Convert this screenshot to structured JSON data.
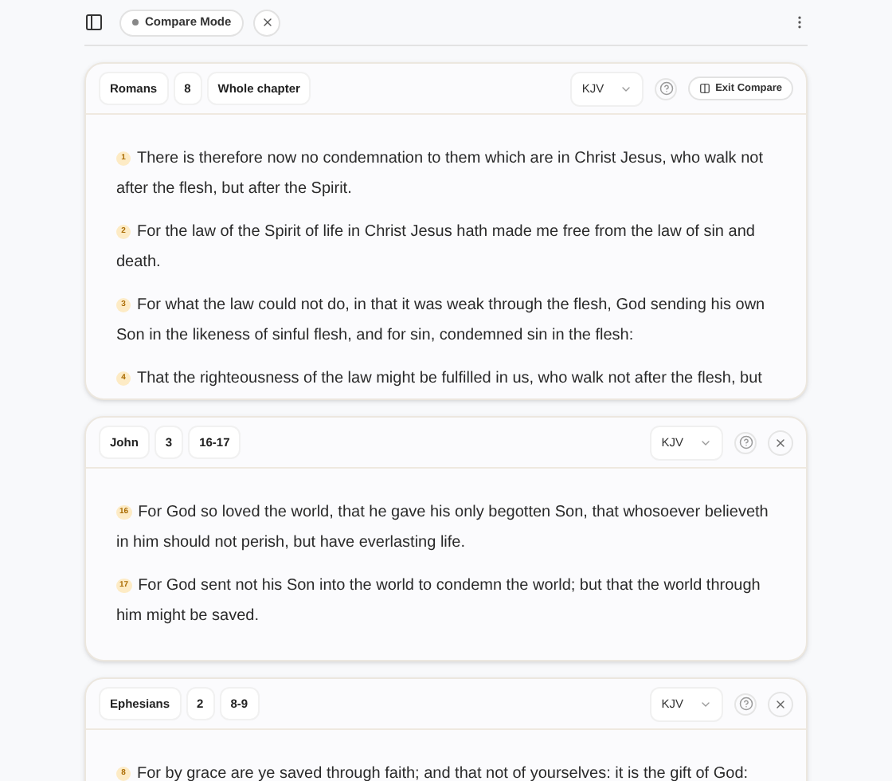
{
  "toolbar": {
    "mode_chip": "Compare Mode"
  },
  "panels": [
    {
      "book": "Romans",
      "chapter": "8",
      "range": "Whole chapter",
      "version": "KJV",
      "action": {
        "kind": "exit",
        "label": "Exit Compare"
      },
      "verses": [
        {
          "number": "1",
          "text": "There is therefore now no condemnation to them which are in Christ Jesus, who walk not after the flesh, but after the Spirit."
        },
        {
          "number": "2",
          "text": "For the law of the Spirit of life in Christ Jesus hath made me free from the law of sin and death."
        },
        {
          "number": "3",
          "text": "For what the law could not do, in that it was weak through the flesh, God sending his own Son in the likeness of sinful flesh, and for sin, condemned sin in the flesh:"
        },
        {
          "number": "4",
          "text": "That the righteousness of the law might be fulfilled in us, who walk not after the flesh, but"
        }
      ]
    },
    {
      "book": "John",
      "chapter": "3",
      "range": "16-17",
      "version": "KJV",
      "action": {
        "kind": "close"
      },
      "verses": [
        {
          "number": "16",
          "text": "For God so loved the world, that he gave his only begotten Son, that whosoever believeth in him should not perish, but have everlasting life."
        },
        {
          "number": "17",
          "text": "For God sent not his Son into the world to condemn the world; but that the world through him might be saved."
        }
      ]
    },
    {
      "book": "Ephesians",
      "chapter": "2",
      "range": "8-9",
      "version": "KJV",
      "action": {
        "kind": "close"
      },
      "verses": [
        {
          "number": "8",
          "text": "For by grace are ye saved through faith; and that not of yourselves: it is the gift of God:"
        }
      ]
    }
  ]
}
